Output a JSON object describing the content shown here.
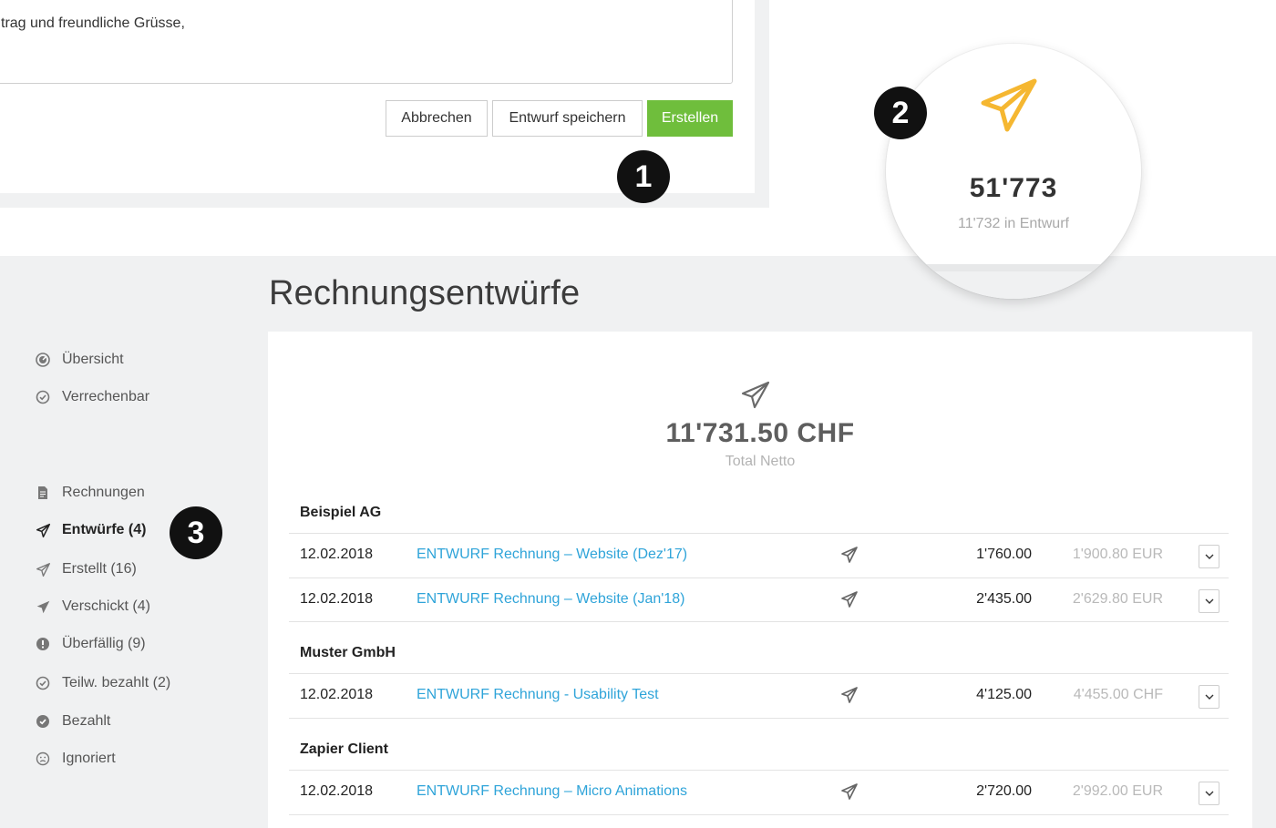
{
  "modal": {
    "text": "trag und freundliche Grüsse,",
    "cancel_label": "Abbrechen",
    "draft_label": "Entwurf speichern",
    "create_label": "Erstellen",
    "create_color": "#6fbe3c"
  },
  "badges": {
    "one": "1",
    "two": "2",
    "three": "3"
  },
  "stats_circle": {
    "icon": "paper-plane-icon",
    "icon_color": "#f5b731",
    "value": "51'773",
    "subtitle": "11'732 in Entwurf"
  },
  "page": {
    "title": "Rechnungsentwürfe"
  },
  "sidebar": {
    "items": [
      {
        "label": "Übersicht",
        "icon": "dashboard-icon"
      },
      {
        "label": "Verrechenbar",
        "icon": "check-circle-icon"
      },
      {
        "label": "Rechnungen",
        "icon": "document-icon"
      },
      {
        "label": "Entwürfe (4)",
        "icon": "paper-plane-outline-icon",
        "active": true
      },
      {
        "label": "Erstellt (16)",
        "icon": "paper-plane-outline-icon"
      },
      {
        "label": "Verschickt (4)",
        "icon": "paper-plane-filled-icon"
      },
      {
        "label": "Überfällig (9)",
        "icon": "exclamation-circle-icon"
      },
      {
        "label": "Teilw. bezahlt (2)",
        "icon": "check-circle-outline-icon"
      },
      {
        "label": "Bezahlt",
        "icon": "check-circle-filled-icon"
      },
      {
        "label": "Ignoriert",
        "icon": "sad-face-icon"
      }
    ]
  },
  "summary": {
    "total": "11'731.50 CHF",
    "label": "Total Netto"
  },
  "groups": [
    {
      "client": "Beispiel AG",
      "rows": [
        {
          "date": "12.02.2018",
          "name": "ENTWURF Rechnung – Website (Dez'17)",
          "amount": "1'760.00",
          "amount_currency": "1'900.80 EUR"
        },
        {
          "date": "12.02.2018",
          "name": "ENTWURF Rechnung – Website (Jan'18)",
          "amount": "2'435.00",
          "amount_currency": "2'629.80 EUR"
        }
      ]
    },
    {
      "client": "Muster GmbH",
      "rows": [
        {
          "date": "12.02.2018",
          "name": "ENTWURF Rechnung - Usability Test",
          "amount": "4'125.00",
          "amount_currency": "4'455.00 CHF"
        }
      ]
    },
    {
      "client": "Zapier Client",
      "rows": [
        {
          "date": "12.02.2018",
          "name": "ENTWURF Rechnung – Micro Animations",
          "amount": "2'720.00",
          "amount_currency": "2'992.00 EUR"
        }
      ]
    }
  ]
}
